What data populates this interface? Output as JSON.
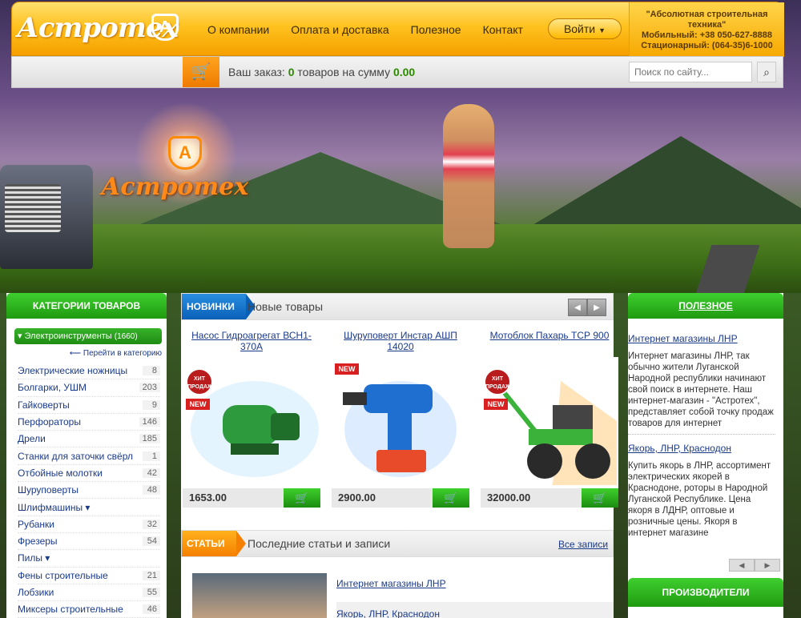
{
  "header": {
    "logo_text": "Астротех",
    "logo_badge": "A",
    "nav": [
      "О компании",
      "Оплата и доставка",
      "Полезное",
      "Контакт"
    ],
    "login_label": "Войти",
    "contact": {
      "company": "\"Абсолютная строительная техника\"",
      "mobile": "Мобильный: +38 050-627-8888",
      "landline": "Стационарный: (064-35)6-1000"
    }
  },
  "order_bar": {
    "label": "Ваш заказ:",
    "count": "0",
    "middle": "товаров на сумму",
    "sum": "0.00",
    "search_placeholder": "Поиск по сайту..."
  },
  "banner": {
    "logo_text": "Астротех",
    "logo_badge": "A"
  },
  "sidebar": {
    "title": "КАТЕГОРИИ ТОВАРОВ",
    "main_category": "Электроинструменты",
    "main_count": "(1660)",
    "goto_label": "Перейти в категорию",
    "items": [
      {
        "label": "Электрические ножницы",
        "count": "8"
      },
      {
        "label": "Болгарки, УШМ",
        "count": "203"
      },
      {
        "label": "Гайковерты",
        "count": "9"
      },
      {
        "label": "Перфораторы",
        "count": "146"
      },
      {
        "label": "Дрели",
        "count": "185"
      },
      {
        "label": "Станки для заточки свёрл",
        "count": "1"
      },
      {
        "label": "Отбойные молотки",
        "count": "42"
      },
      {
        "label": "Шуруповерты",
        "count": "48"
      },
      {
        "label": "Шлифмашины ▾",
        "count": ""
      },
      {
        "label": "Рубанки",
        "count": "32"
      },
      {
        "label": "Фрезеры",
        "count": "54"
      },
      {
        "label": "Пилы ▾",
        "count": ""
      },
      {
        "label": "Фены строительные",
        "count": "21"
      },
      {
        "label": "Лобзики",
        "count": "55"
      },
      {
        "label": "Миксеры строительные",
        "count": "46"
      }
    ]
  },
  "new_products": {
    "tag": "НОВИНКИ",
    "title": "Новые товары",
    "items": [
      {
        "name": "Насос Гидроагрегат ВСН1-370А",
        "price": "1653.00",
        "hit": true,
        "new": true
      },
      {
        "name": "Шуруповерт Инстар АШП 14020",
        "price": "2900.00",
        "hit": false,
        "new": true
      },
      {
        "name": "Мотоблок Пахарь ТСР 900",
        "price": "32000.00",
        "hit": true,
        "new": true
      }
    ],
    "hit_label": "ХИТ ПРОДАЖ",
    "new_label": "NEW"
  },
  "articles": {
    "tag": "СТАТЬИ",
    "title": "Последние статьи и записи",
    "all_link": "Все записи",
    "items": [
      "Интернет магазины ЛНР",
      "Якорь, ЛНР, Краснодон"
    ]
  },
  "useful": {
    "title": "ПОЛЕЗНОЕ",
    "items": [
      {
        "title": "Интернет магазины ЛНР",
        "text": "Интернет магазины ЛНР, так обычно жители Луганской Народной республики начинают свой поиск в интернете. Наш интернет-магазин - \"Астротех\", представляет собой точку продаж товаров для интернет"
      },
      {
        "title": "Якорь, ЛНР, Краснодон",
        "text": "Купить якорь в ЛНР, ассортимент электрических якорей в Краснодоне, роторы в Народной Луганской Республике. Цена якоря в ЛДНР, оптовые и розничные цены. Якоря в интернет магазине"
      }
    ]
  },
  "manufacturers": {
    "title": "ПРОИЗВОДИТЕЛИ"
  },
  "colors": {
    "accent_orange": "#f5a000",
    "accent_green": "#1f9a10",
    "accent_blue": "#0a60b8"
  }
}
